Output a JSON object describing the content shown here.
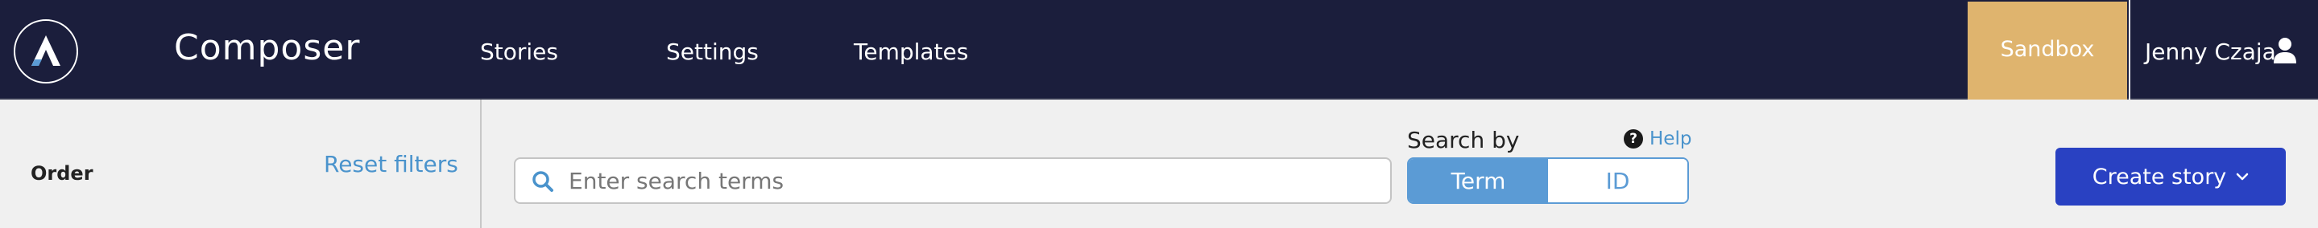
{
  "header": {
    "app_title": "Composer",
    "nav": {
      "stories": "Stories",
      "settings": "Settings",
      "templates": "Templates"
    },
    "environment_badge": "Sandbox",
    "user_name": "Jenny Czaja",
    "icons": {
      "logo": "composer-logo-icon",
      "user": "user-icon"
    }
  },
  "sidebar": {
    "order_label": "Order",
    "reset_filters": "Reset filters"
  },
  "search": {
    "placeholder": "Enter search terms",
    "value": "",
    "search_by_label": "Search by",
    "help_label": "Help",
    "modes": [
      "Term",
      "ID"
    ],
    "selected_mode": "Term"
  },
  "actions": {
    "create_story": "Create story"
  },
  "colors": {
    "header_bg": "#1b1e3c",
    "sandbox": "#dfb46e",
    "accent": "#5b9bd5",
    "link": "#4a93cc",
    "primary_button": "#2941c2"
  }
}
